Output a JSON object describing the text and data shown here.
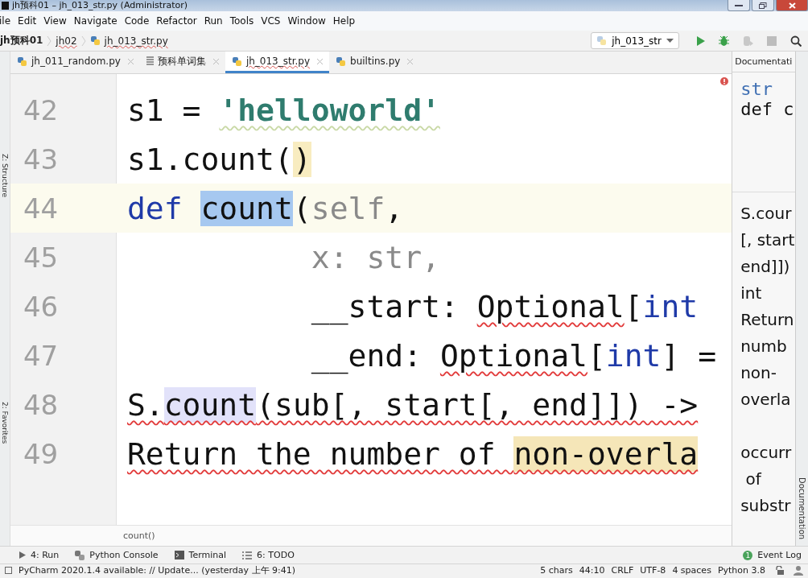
{
  "window": {
    "title": "jh预科01 – jh_013_str.py (Administrator)"
  },
  "menu": [
    "ile",
    "Edit",
    "View",
    "Navigate",
    "Code",
    "Refactor",
    "Run",
    "Tools",
    "VCS",
    "Window",
    "Help"
  ],
  "breadcrumbs": [
    {
      "label": "jh预科01",
      "kind": "project"
    },
    {
      "label": "jh02",
      "kind": "folder"
    },
    {
      "label": "jh_013_str.py",
      "kind": "file"
    }
  ],
  "run_config": "jh_013_str",
  "side_labels": [
    "Z: Structure",
    "2: Favorites"
  ],
  "tabs": [
    {
      "label": "jh_011_random.py",
      "kind": "python",
      "selected": false
    },
    {
      "label": "预科单词集",
      "kind": "text",
      "selected": false
    },
    {
      "label": "jh_013_str.py",
      "kind": "python",
      "selected": true
    },
    {
      "label": "builtins.py",
      "kind": "python",
      "selected": false
    }
  ],
  "editor": {
    "lines": [
      {
        "number": "42",
        "current": false,
        "tokens": [
          {
            "text": "s1 = ",
            "kind": "plain",
            "squiggle": false
          },
          {
            "text": "'helloworld'",
            "kind": "string",
            "squiggle": true
          }
        ]
      },
      {
        "number": "43",
        "current": false,
        "tokens": [
          {
            "text": "s1.count(",
            "kind": "plain",
            "squiggle": false
          },
          {
            "text": ")",
            "kind": "plain",
            "color": "#f8ecc0",
            "squiggle": false
          }
        ]
      },
      {
        "number": "44",
        "current": true,
        "tokens": [
          {
            "text": "def ",
            "kind": "keyword",
            "squiggle": false
          },
          {
            "text": "count",
            "kind": "plain",
            "color": "#a6c8f0",
            "squiggle": false
          },
          {
            "text": "(",
            "kind": "plain",
            "squiggle": false
          },
          {
            "text": "self",
            "kind": "dim",
            "squiggle": false
          },
          {
            "text": ",",
            "kind": "plain",
            "squiggle": false
          }
        ]
      },
      {
        "number": "45",
        "current": false,
        "tokens": [
          {
            "text": "          x: str,",
            "kind": "dim",
            "squiggle": false
          }
        ]
      },
      {
        "number": "46",
        "current": false,
        "tokens": [
          {
            "text": "          __start: ",
            "kind": "plain",
            "squiggle": false
          },
          {
            "text": "Optional",
            "kind": "plain",
            "squiggle": true
          },
          {
            "text": "[",
            "kind": "plain",
            "squiggle": false
          },
          {
            "text": "int",
            "kind": "type",
            "squiggle": false
          }
        ]
      },
      {
        "number": "47",
        "current": false,
        "tokens": [
          {
            "text": "          __end: ",
            "kind": "plain",
            "squiggle": false
          },
          {
            "text": "Optional",
            "kind": "plain",
            "squiggle": true
          },
          {
            "text": "[",
            "kind": "plain",
            "squiggle": false
          },
          {
            "text": "int",
            "kind": "type",
            "squiggle": false
          },
          {
            "text": "] =",
            "kind": "plain",
            "squiggle": false
          }
        ]
      },
      {
        "number": "48",
        "current": false,
        "tokens": [
          {
            "text": "S.",
            "kind": "plain",
            "squiggle": true
          },
          {
            "text": "count",
            "kind": "plain",
            "color": "#e2e2fa",
            "squiggle": true
          },
          {
            "text": "(sub[, start[, end]]) ->",
            "kind": "plain",
            "squiggle": true
          }
        ]
      },
      {
        "number": "49",
        "current": false,
        "tokens": [
          {
            "text": "Return the number of ",
            "kind": "plain",
            "squiggle": true
          },
          {
            "text": "non-overla",
            "kind": "plain",
            "color": "#f5e6b8",
            "squiggle": true
          }
        ]
      }
    ]
  },
  "breadcrumb_footer": "count()",
  "documentation": {
    "header": "Documentati",
    "class_name": "str",
    "signature": "def c",
    "body": [
      [
        "S.cour",
        "[, start",
        "end]])",
        "int",
        "Return",
        "numb",
        "non-",
        "overla"
      ],
      [
        "occurr",
        " of",
        "substr"
      ]
    ],
    "side_label": "Documentation"
  },
  "tool_windows": [
    {
      "label": "4: Run",
      "kind": "run"
    },
    {
      "label": "Python Console",
      "kind": "console"
    },
    {
      "label": "Terminal",
      "kind": "terminal"
    },
    {
      "label": "6: TODO",
      "kind": "todo"
    }
  ],
  "event_log": {
    "label": "Event Log",
    "count": "1"
  },
  "status_bar": {
    "message": "PyCharm 2020.1.4 available: // Update... (yesterday 上午 9:41)",
    "items": [
      "5 chars",
      "44:10",
      "CRLF",
      "UTF-8",
      "4 spaces",
      "Python 3.8"
    ]
  }
}
